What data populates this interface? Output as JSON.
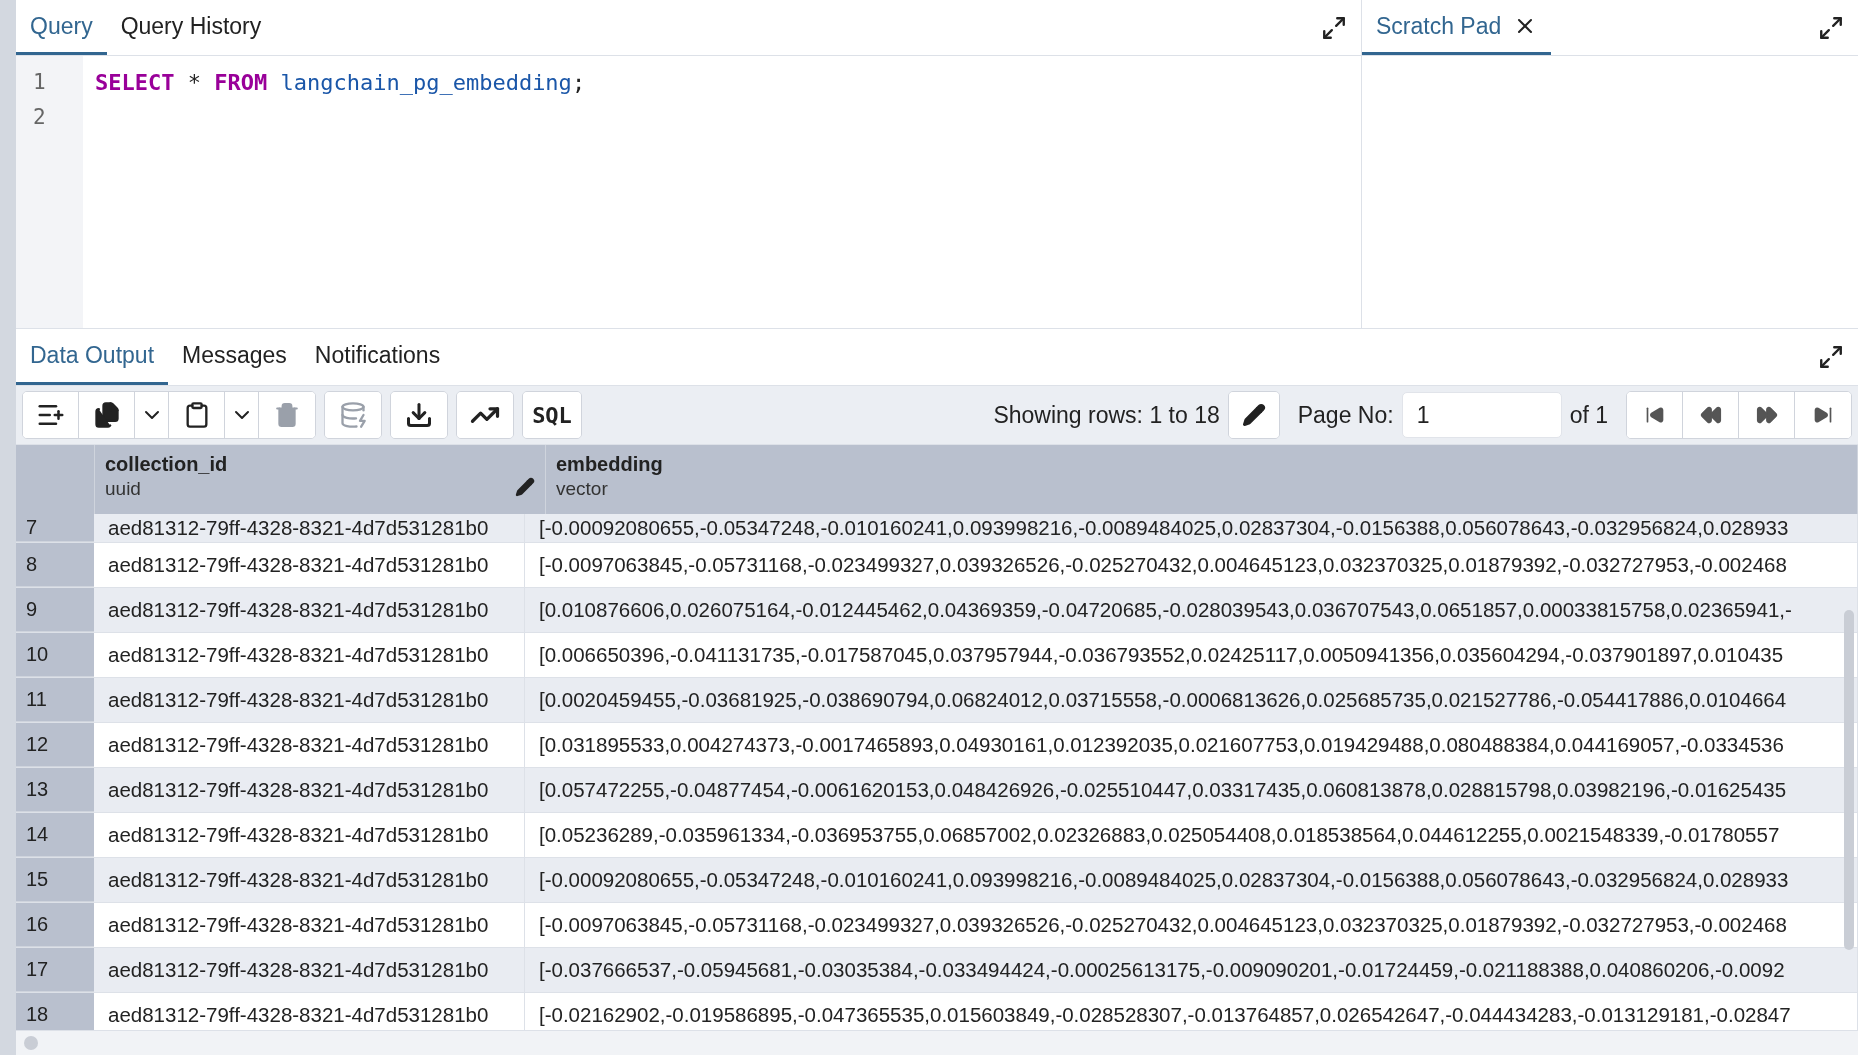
{
  "query_tabs": [
    {
      "label": "Query",
      "selected": true
    },
    {
      "label": "Query History",
      "selected": false
    }
  ],
  "editor": {
    "lines": [
      {
        "number": "1",
        "tokens": [
          {
            "kind": "keyword",
            "text": "SELECT"
          },
          {
            "kind": "plain",
            "text": "*"
          },
          {
            "kind": "keyword",
            "text": "FROM"
          },
          {
            "kind": "identifier",
            "text": "langchain_pg_embedding"
          },
          {
            "kind": "punctuation",
            "text": ";"
          }
        ]
      },
      {
        "number": "2"
      }
    ]
  },
  "scratch_tabs": [
    {
      "label": "Scratch Pad",
      "selected": true
    }
  ],
  "output_tabs": [
    {
      "label": "Data Output",
      "selected": true
    },
    {
      "label": "Messages",
      "selected": false
    },
    {
      "label": "Notifications",
      "selected": false
    }
  ],
  "toolbar": {
    "delete_button": {
      "disabled": true
    },
    "save_data_button": {
      "disabled": true
    },
    "sql_button": {
      "label": "SQL"
    },
    "showing": "Showing rows: 1 to 18",
    "page_label": "Page No:",
    "page_value": "1",
    "page_of": "of 1"
  },
  "table": {
    "columns": [
      {
        "name": "collection_id",
        "type": "uuid"
      },
      {
        "name": "embedding",
        "type": "vector"
      }
    ],
    "rows": [
      {
        "number": "7",
        "collection_id": "aed81312-79ff-4328-8321-4d7d531281b0",
        "embedding": "[-0.00092080655,-0.05347248,-0.010160241,0.093998216,-0.0089484025,0.02837304,-0.0156388,0.056078643,-0.032956824,0.028933"
      },
      {
        "number": "8",
        "collection_id": "aed81312-79ff-4328-8321-4d7d531281b0",
        "embedding": "[-0.0097063845,-0.05731168,-0.023499327,0.039326526,-0.025270432,0.004645123,0.032370325,0.01879392,-0.032727953,-0.002468"
      },
      {
        "number": "9",
        "collection_id": "aed81312-79ff-4328-8321-4d7d531281b0",
        "embedding": "[0.010876606,0.026075164,-0.012445462,0.04369359,-0.04720685,-0.028039543,0.036707543,0.0651857,0.00033815758,0.02365941,-"
      },
      {
        "number": "10",
        "collection_id": "aed81312-79ff-4328-8321-4d7d531281b0",
        "embedding": "[0.006650396,-0.041131735,-0.017587045,0.037957944,-0.036793552,0.02425117,0.0050941356,0.035604294,-0.037901897,0.010435"
      },
      {
        "number": "11",
        "collection_id": "aed81312-79ff-4328-8321-4d7d531281b0",
        "embedding": "[0.0020459455,-0.03681925,-0.038690794,0.06824012,0.03715558,-0.0006813626,0.025685735,0.021527786,-0.054417886,0.0104664"
      },
      {
        "number": "12",
        "collection_id": "aed81312-79ff-4328-8321-4d7d531281b0",
        "embedding": "[0.031895533,0.004274373,-0.0017465893,0.04930161,0.012392035,0.021607753,0.019429488,0.080488384,0.044169057,-0.0334536"
      },
      {
        "number": "13",
        "collection_id": "aed81312-79ff-4328-8321-4d7d531281b0",
        "embedding": "[0.057472255,-0.04877454,-0.0061620153,0.048426926,-0.025510447,0.03317435,0.060813878,0.028815798,0.03982196,-0.01625435"
      },
      {
        "number": "14",
        "collection_id": "aed81312-79ff-4328-8321-4d7d531281b0",
        "embedding": "[0.05236289,-0.035961334,-0.036953755,0.06857002,0.02326883,0.025054408,0.018538564,0.044612255,0.0021548339,-0.01780557"
      },
      {
        "number": "15",
        "collection_id": "aed81312-79ff-4328-8321-4d7d531281b0",
        "embedding": "[-0.00092080655,-0.05347248,-0.010160241,0.093998216,-0.0089484025,0.02837304,-0.0156388,0.056078643,-0.032956824,0.028933"
      },
      {
        "number": "16",
        "collection_id": "aed81312-79ff-4328-8321-4d7d531281b0",
        "embedding": "[-0.0097063845,-0.05731168,-0.023499327,0.039326526,-0.025270432,0.004645123,0.032370325,0.01879392,-0.032727953,-0.002468"
      },
      {
        "number": "17",
        "collection_id": "aed81312-79ff-4328-8321-4d7d531281b0",
        "embedding": "[-0.037666537,-0.05945681,-0.03035384,-0.033494424,-0.00025613175,-0.009090201,-0.01724459,-0.021188388,0.040860206,-0.0092"
      },
      {
        "number": "18",
        "collection_id": "aed81312-79ff-4328-8321-4d7d531281b0",
        "embedding": "[-0.02162902,-0.019586895,-0.047365535,0.015603849,-0.028528307,-0.013764857,0.026542647,-0.044434283,-0.013129181,-0.02847"
      }
    ]
  }
}
